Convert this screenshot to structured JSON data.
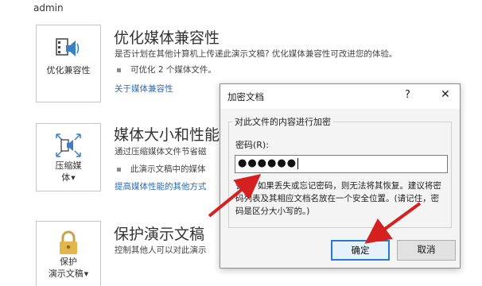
{
  "user": "admin",
  "sections": [
    {
      "tile_label": "优化兼容性",
      "title": "优化媒体兼容性",
      "description": "是否计划在其他计算机上传递此演示文稿? 优化媒体兼容性可改进您的体验。",
      "bullet": "可优化 2 个媒体文件。",
      "link": "关于媒体兼容性"
    },
    {
      "tile_label_line1": "压缩媒",
      "tile_label_line2": "体",
      "title": "媒体大小和性能",
      "description": "通过压缩媒体文件节省磁",
      "bullet": "此演示文稿中的媒体",
      "link": "提高媒体性能的其他方式"
    },
    {
      "tile_label_line1": "保护",
      "tile_label_line2": "演示文稿",
      "title": "保护演示文稿",
      "description": "控制其他人可以对此演示"
    }
  ],
  "dialog": {
    "title": "加密文档",
    "help": "?",
    "close": "✕",
    "group_label": "对此文件的内容进行加密",
    "password_label": "密码(R):",
    "password_value": "●●●●●●",
    "warning": "警告: 如果丢失或忘记密码，则无法将其恢复。建议将密码列表及其相应文档名放在一个安全位置。(请记住，密码是区分大小写的。)",
    "ok_label": "确定",
    "cancel_label": "取消"
  },
  "colors": {
    "link": "#2e6ab5",
    "arrow": "#d62020",
    "focus": "#2a78d6"
  },
  "icons": [
    "media-compat-icon",
    "compress-media-icon",
    "lock-icon"
  ]
}
